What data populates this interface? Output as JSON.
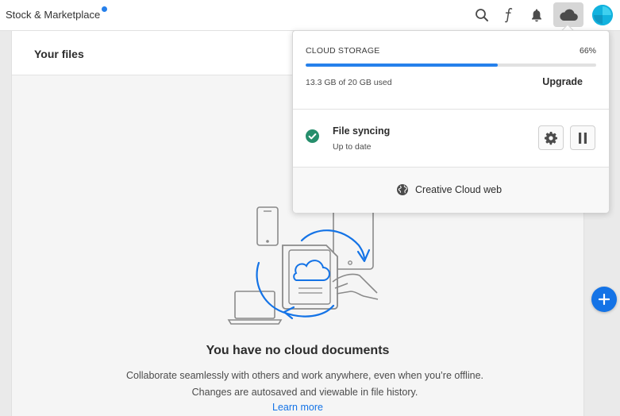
{
  "topbar": {
    "nav_title": "Stock & Marketplace",
    "icons": [
      "search-icon",
      "fonts-icon",
      "bell-icon",
      "cloud-icon",
      "avatar"
    ]
  },
  "files": {
    "title": "Your files",
    "empty_title": "You have no cloud documents",
    "empty_description": "Collaborate seamlessly with others and work anywhere, even when you’re offline. Changes are autosaved and viewable in file history.",
    "learn_more": "Learn more"
  },
  "storage": {
    "label": "CLOUD STORAGE",
    "percent_label": "66%",
    "percent_value": 0.66,
    "used_text": "13.3 GB of 20 GB used",
    "upgrade_label": "Upgrade"
  },
  "sync": {
    "title": "File syncing",
    "status": "Up to date"
  },
  "footer": {
    "web_link": "Creative Cloud web"
  },
  "colors": {
    "accent": "#2680eb",
    "link": "#1473e6",
    "success": "#268e6c",
    "avatar": "#12b2de"
  }
}
